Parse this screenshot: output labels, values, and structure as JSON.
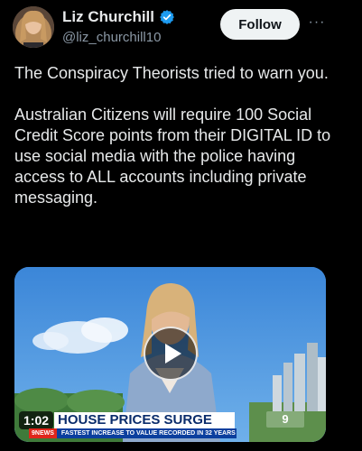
{
  "author": {
    "display_name": "Liz Churchill",
    "handle": "@liz_churchill10",
    "verified": true
  },
  "follow_button": {
    "label": "Follow"
  },
  "more_icon": {
    "glyph": "···"
  },
  "tweet": {
    "line1": "The Conspiracy Theorists tried to warn you.",
    "line2": "Australian Citizens will require 100 Social Credit Score points from their DIGITAL ID to use social media with the police having access to ALL accounts including private messaging."
  },
  "video": {
    "duration": "1:02",
    "chyron_headline": "HOUSE PRICES SURGE",
    "chyron_tag": "9NEWS",
    "chyron_subline": "FASTEST INCREASE TO VALUE RECORDED IN 32 YEARS",
    "network_logo": "9"
  },
  "colors": {
    "background": "#000000",
    "text": "#e7e9ea",
    "secondary_text": "#8b98a5",
    "verified_badge": "#1d9bf0",
    "follow_bg": "#eff3f4"
  }
}
